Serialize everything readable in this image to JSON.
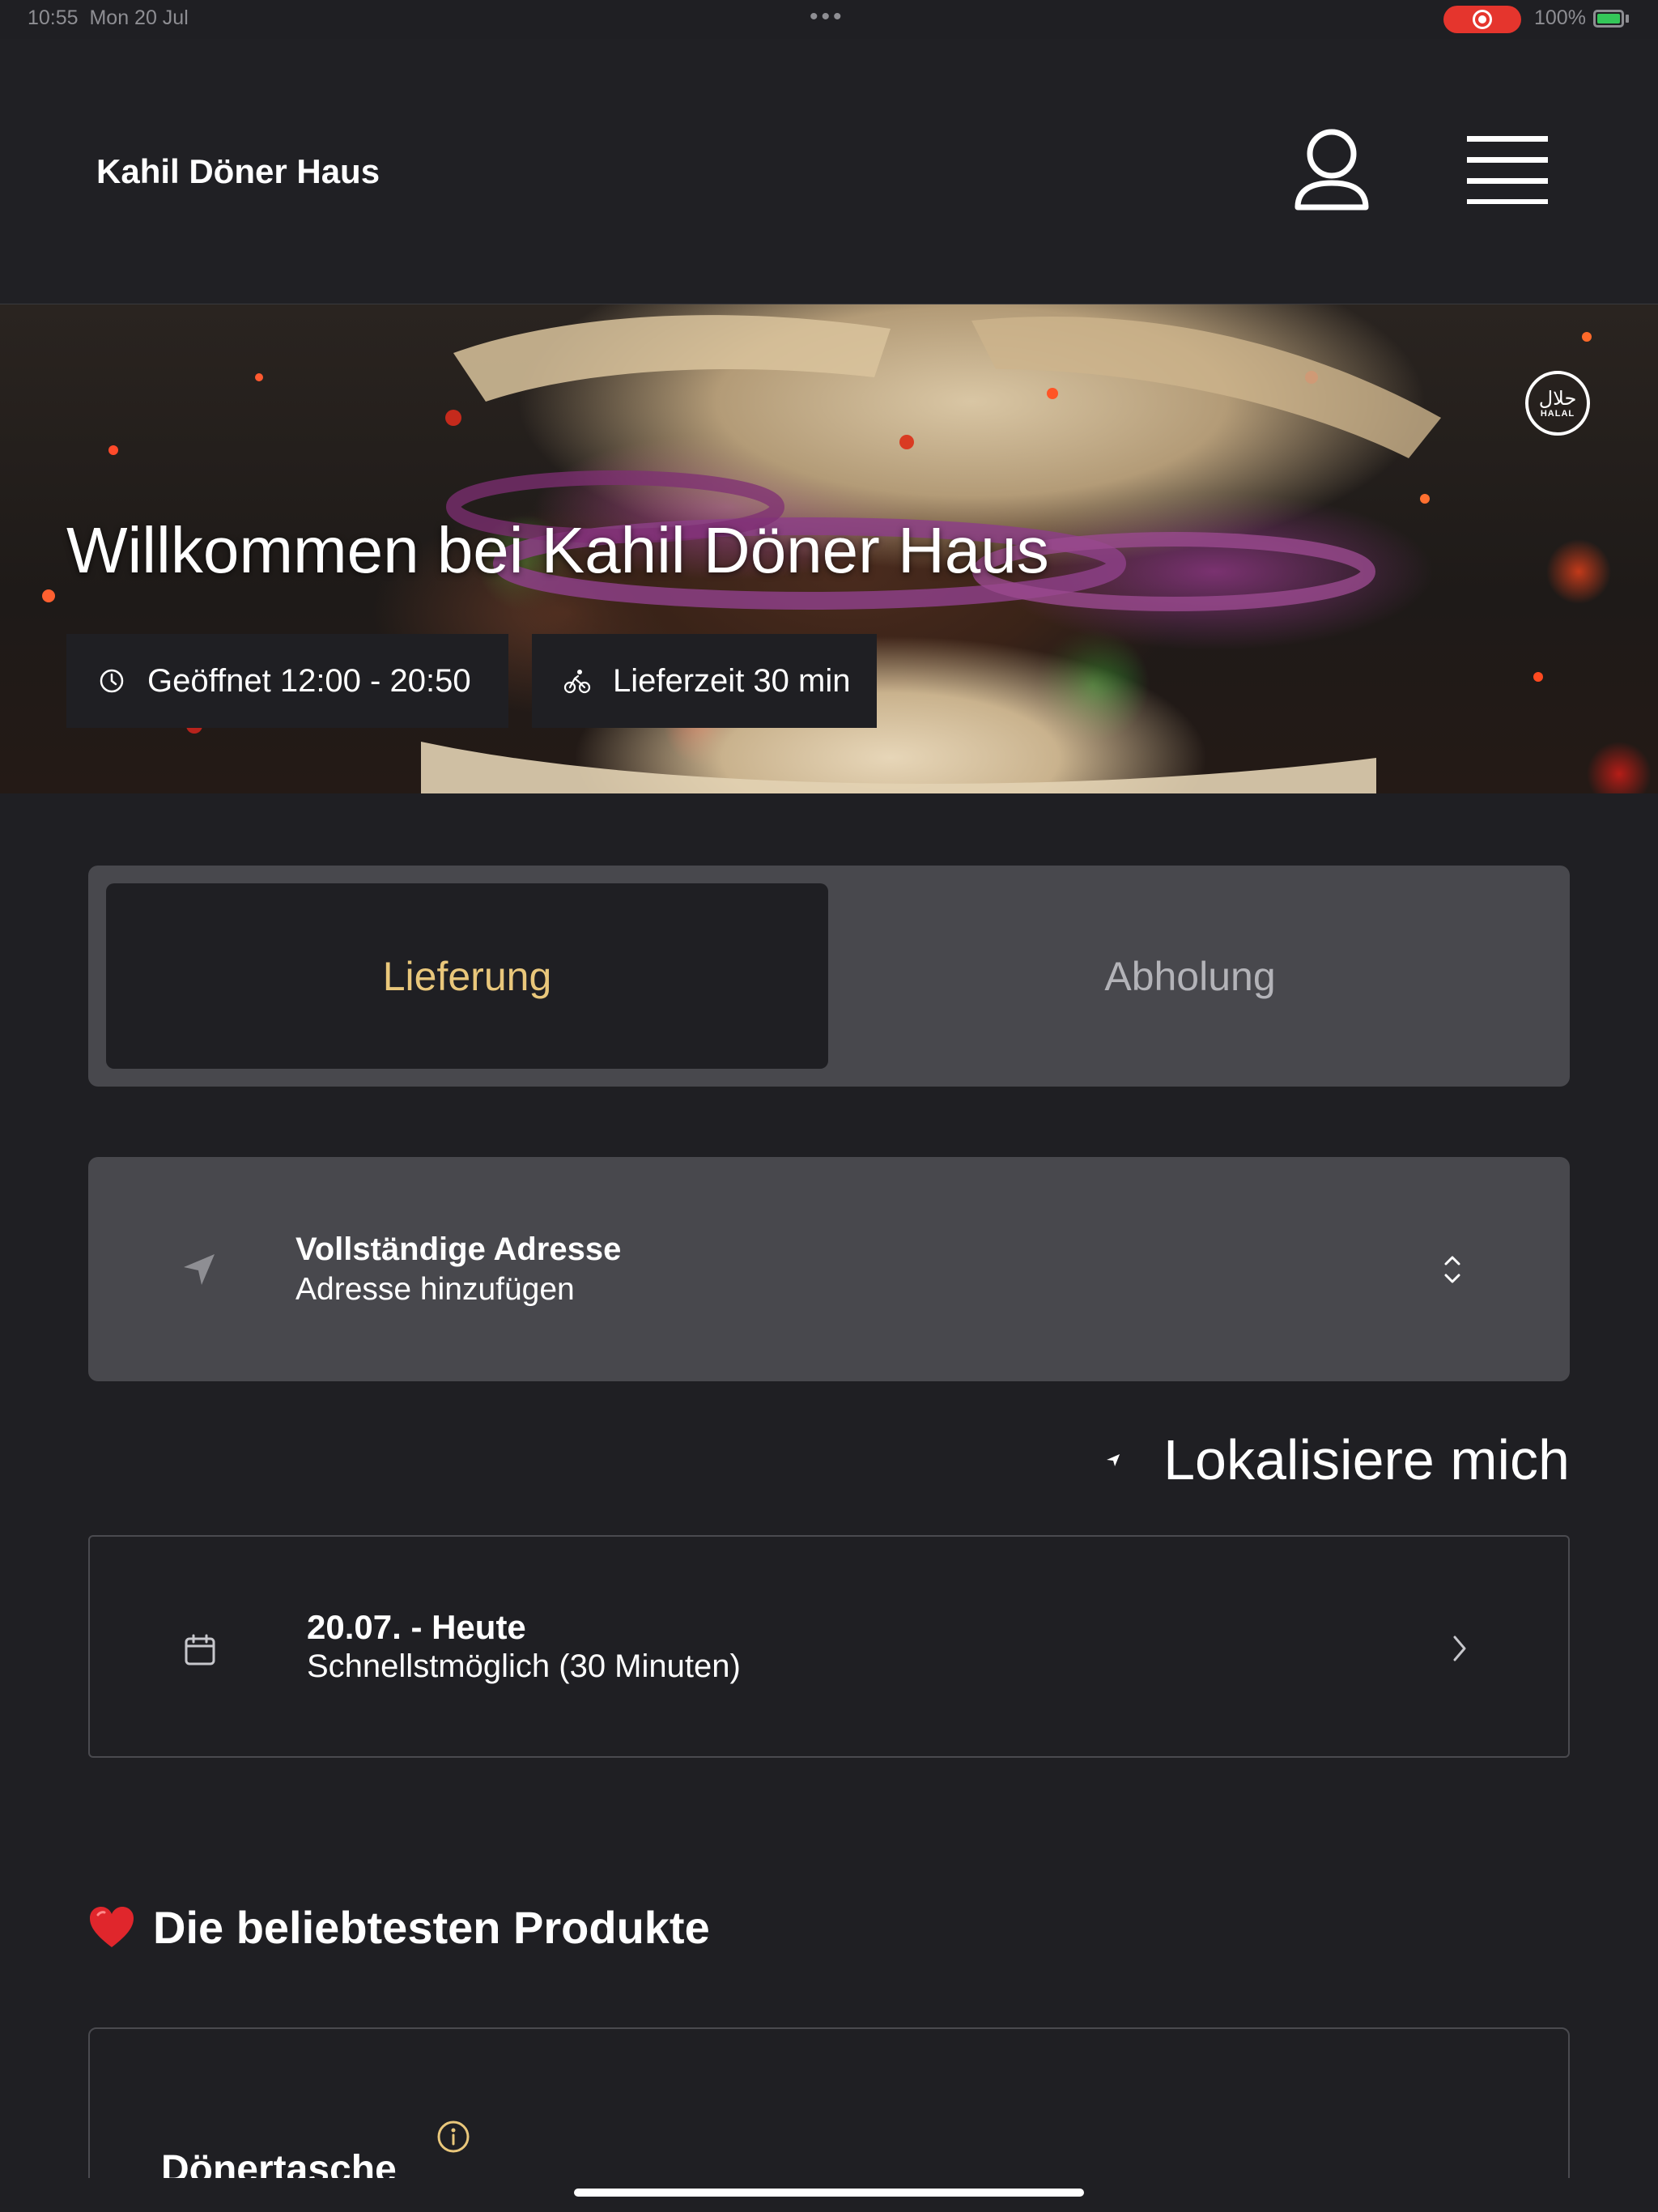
{
  "status_bar": {
    "time": "10:55",
    "date": "Mon 20 Jul",
    "battery": "100%"
  },
  "header": {
    "brand": "Kahil Döner Haus",
    "icons": [
      "user-icon",
      "hamburger-menu-icon"
    ]
  },
  "hero": {
    "title": "Willkommen bei Kahil Döner Haus",
    "hours": "Geöffnet 12:00 - 20:50",
    "delivery_time": "Lieferzeit 30 min",
    "badge_ar": "حلال",
    "badge_en": "HALAL"
  },
  "order_mode": {
    "options": [
      "Lieferung",
      "Abholung"
    ],
    "selected": "Lieferung"
  },
  "address": {
    "title": "Vollständige Adresse",
    "placeholder": "Adresse hinzufügen"
  },
  "locate": {
    "label": "Lokalisiere mich"
  },
  "schedule": {
    "date": "20.07. - Heute",
    "time": "Schnellstmöglich (30 Minuten)"
  },
  "popular": {
    "title": "Die beliebtesten Produkte",
    "products": [
      {
        "name": "Dönertasche"
      }
    ]
  },
  "colors": {
    "background": "#1f1f23",
    "card": "#48484d",
    "accent": "#e9c77b",
    "record": "#e5352d"
  }
}
